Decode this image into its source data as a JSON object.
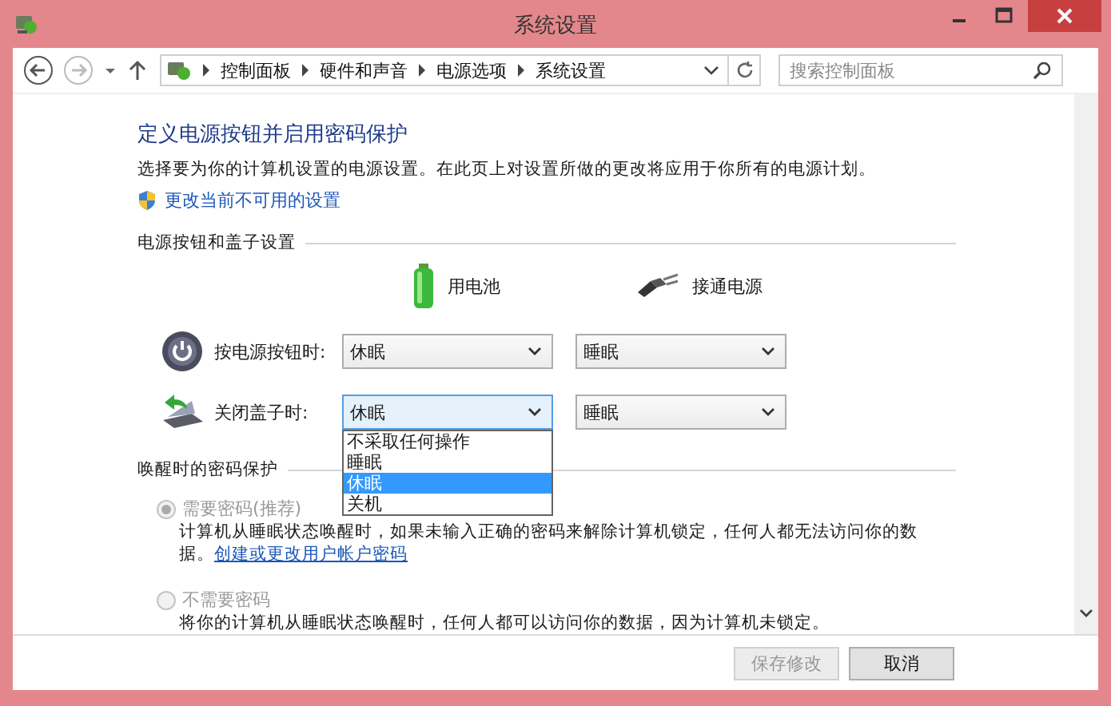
{
  "window": {
    "title": "系统设置"
  },
  "nav": {
    "back_disabled": false,
    "forward_disabled": true,
    "breadcrumbs": [
      "控制面板",
      "硬件和声音",
      "电源选项",
      "系统设置"
    ],
    "search_placeholder": "搜索控制面板"
  },
  "heading": "定义电源按钮并启用密码保护",
  "description": "选择要为你的计算机设置的电源设置。在此页上对设置所做的更改将应用于你所有的电源计划。",
  "admin_link": "更改当前不可用的设置",
  "power_section": {
    "title": "电源按钮和盖子设置",
    "columns": [
      {
        "label": "用电池",
        "kind": "battery"
      },
      {
        "label": "接通电源",
        "kind": "plug"
      }
    ],
    "rows": [
      {
        "kind": "power",
        "label": "按电源按钮时:",
        "values": [
          "休眠",
          "睡眠"
        ],
        "expanded": false
      },
      {
        "kind": "lid",
        "label": "关闭盖子时:",
        "values": [
          "休眠",
          "睡眠"
        ],
        "expanded": true,
        "options": [
          {
            "label": "不采取任何操作",
            "selected": false
          },
          {
            "label": "睡眠",
            "selected": false
          },
          {
            "label": "休眠",
            "selected": true
          },
          {
            "label": "关机",
            "selected": false
          }
        ]
      }
    ]
  },
  "password_section": {
    "title": "唤醒时的密码保护",
    "options": [
      {
        "label": "需要密码(推荐)",
        "selected": true,
        "disabled": true,
        "description": "计算机从睡眠状态唤醒时，如果未输入正确的密码来解除计算机锁定，任何人都无法访问你的数据。",
        "link": "创建或更改用户帐户密码"
      },
      {
        "label": "不需要密码",
        "selected": false,
        "disabled": true,
        "description": "将你的计算机从睡眠状态唤醒时，任何人都可以访问你的数据，因为计算机未锁定。"
      }
    ]
  },
  "buttons": [
    {
      "label": "保存修改",
      "disabled": true
    },
    {
      "label": "取消",
      "disabled": false
    }
  ]
}
